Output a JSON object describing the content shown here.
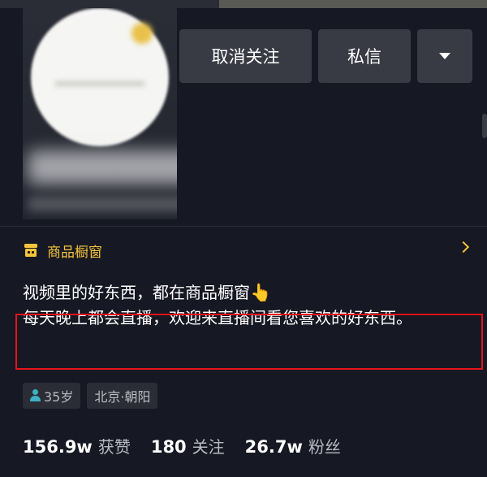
{
  "header": {
    "buttons": {
      "unfollow": "取消关注",
      "message": "私信"
    }
  },
  "shop_window": {
    "label": "商品橱窗",
    "icon": "shop-icon",
    "accent_color": "#f5c33b"
  },
  "bio": {
    "line1": "视频里的好东西，都在商品橱窗",
    "line1_emoji": "👆",
    "line2": "每天晚上都会直播，欢迎来直播间看您喜欢的好东西。"
  },
  "tags": [
    {
      "label": "35岁",
      "icon": "person-icon"
    },
    {
      "label": "北京·朝阳"
    }
  ],
  "stats": [
    {
      "value": "156.9w",
      "label": "获赞"
    },
    {
      "value": "180",
      "label": "关注"
    },
    {
      "value": "26.7w",
      "label": "粉丝"
    }
  ],
  "highlight_color": "#e6131b"
}
